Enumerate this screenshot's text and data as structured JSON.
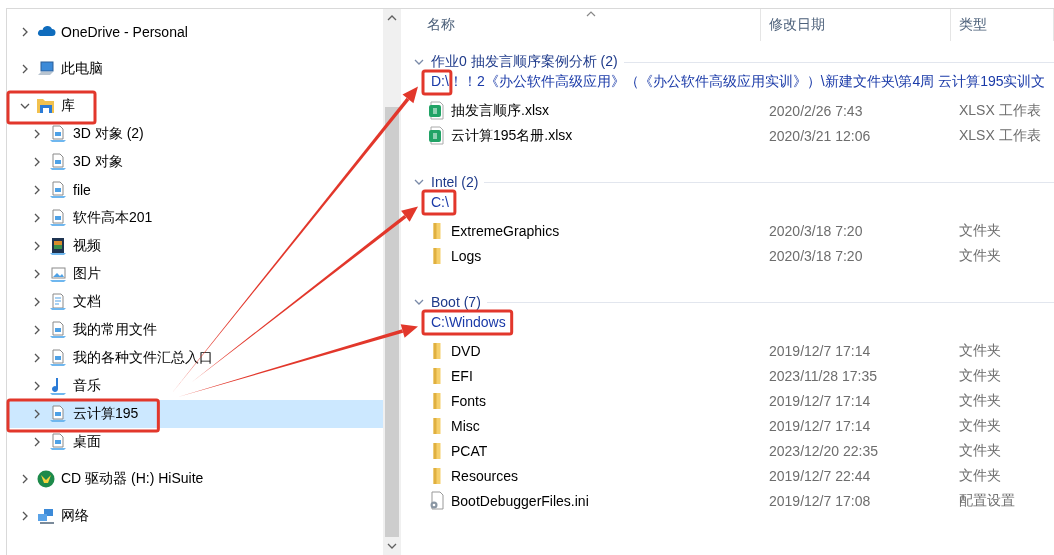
{
  "nav": {
    "items": [
      {
        "label": "OneDrive - Personal",
        "kind": "cloud",
        "expanded": false,
        "selected": false,
        "highlighted": false
      },
      {
        "label": "此电脑",
        "kind": "computer",
        "expanded": false,
        "selected": false,
        "highlighted": false
      },
      {
        "label": "库",
        "kind": "library",
        "expanded": true,
        "selected": false,
        "highlighted": true,
        "children": [
          {
            "label": "3D 对象 (2)",
            "kind": "library-folder",
            "expanded": false,
            "selected": false,
            "highlighted": false
          },
          {
            "label": "3D 对象",
            "kind": "library-folder",
            "expanded": false,
            "selected": false,
            "highlighted": false
          },
          {
            "label": "file",
            "kind": "library-folder",
            "expanded": false,
            "selected": false,
            "highlighted": false
          },
          {
            "label": "软件高本201",
            "kind": "library-folder",
            "expanded": false,
            "selected": false,
            "highlighted": false
          },
          {
            "label": "视频",
            "kind": "video",
            "expanded": false,
            "selected": false,
            "highlighted": false
          },
          {
            "label": "图片",
            "kind": "pictures",
            "expanded": false,
            "selected": false,
            "highlighted": false
          },
          {
            "label": "文档",
            "kind": "documents",
            "expanded": false,
            "selected": false,
            "highlighted": false
          },
          {
            "label": "我的常用文件",
            "kind": "library-folder",
            "expanded": false,
            "selected": false,
            "highlighted": false
          },
          {
            "label": "我的各种文件汇总入口",
            "kind": "library-folder",
            "expanded": false,
            "selected": false,
            "highlighted": false
          },
          {
            "label": "音乐",
            "kind": "music",
            "expanded": false,
            "selected": false,
            "highlighted": false
          },
          {
            "label": "云计算195",
            "kind": "library-folder",
            "expanded": false,
            "selected": true,
            "highlighted": true
          },
          {
            "label": "桌面",
            "kind": "library-folder",
            "expanded": false,
            "selected": false,
            "highlighted": false
          }
        ]
      },
      {
        "label": "CD 驱动器 (H:) HiSuite",
        "kind": "cd-drive",
        "expanded": false,
        "selected": false,
        "highlighted": false
      },
      {
        "label": "网络",
        "kind": "network",
        "expanded": false,
        "selected": false,
        "highlighted": false
      }
    ]
  },
  "columns": [
    "名称",
    "修改日期",
    "类型"
  ],
  "groups": [
    {
      "title": "作业0 抽发言顺序案例分析 (2)",
      "expanded": true,
      "path": "D:\\！！2《办公软件高级应用》（《办公软件高级应用实训》）\\新建文件夹\\第4周 云计算195实训文",
      "path_highlighted": true,
      "arrow": true,
      "files": [
        {
          "name": "抽发言顺序.xlsx",
          "kind": "spreadsheet",
          "modified": "2020/2/26 7:43",
          "type": "XLSX 工作表"
        },
        {
          "name": "云计算195名册.xlsx",
          "kind": "spreadsheet",
          "modified": "2020/3/21 12:06",
          "type": "XLSX 工作表"
        }
      ]
    },
    {
      "title": "Intel (2)",
      "expanded": true,
      "path": "C:\\",
      "path_highlighted": true,
      "arrow": true,
      "files": [
        {
          "name": "ExtremeGraphics",
          "kind": "folder",
          "modified": "2020/3/18 7:20",
          "type": "文件夹"
        },
        {
          "name": "Logs",
          "kind": "folder",
          "modified": "2020/3/18 7:20",
          "type": "文件夹"
        }
      ]
    },
    {
      "title": "Boot (7)",
      "expanded": true,
      "path": "C:\\Windows",
      "path_highlighted": true,
      "arrow": true,
      "files": [
        {
          "name": "DVD",
          "kind": "folder",
          "modified": "2019/12/7 17:14",
          "type": "文件夹"
        },
        {
          "name": "EFI",
          "kind": "folder",
          "modified": "2023/11/28 17:35",
          "type": "文件夹"
        },
        {
          "name": "Fonts",
          "kind": "folder",
          "modified": "2019/12/7 17:14",
          "type": "文件夹"
        },
        {
          "name": "Misc",
          "kind": "folder",
          "modified": "2019/12/7 17:14",
          "type": "文件夹"
        },
        {
          "name": "PCAT",
          "kind": "folder",
          "modified": "2023/12/20 22:35",
          "type": "文件夹"
        },
        {
          "name": "Resources",
          "kind": "folder",
          "modified": "2019/12/7 22:44",
          "type": "文件夹"
        },
        {
          "name": "BootDebuggerFiles.ini",
          "kind": "settings-file",
          "modified": "2019/12/7 17:08",
          "type": "配置设置"
        }
      ]
    }
  ]
}
